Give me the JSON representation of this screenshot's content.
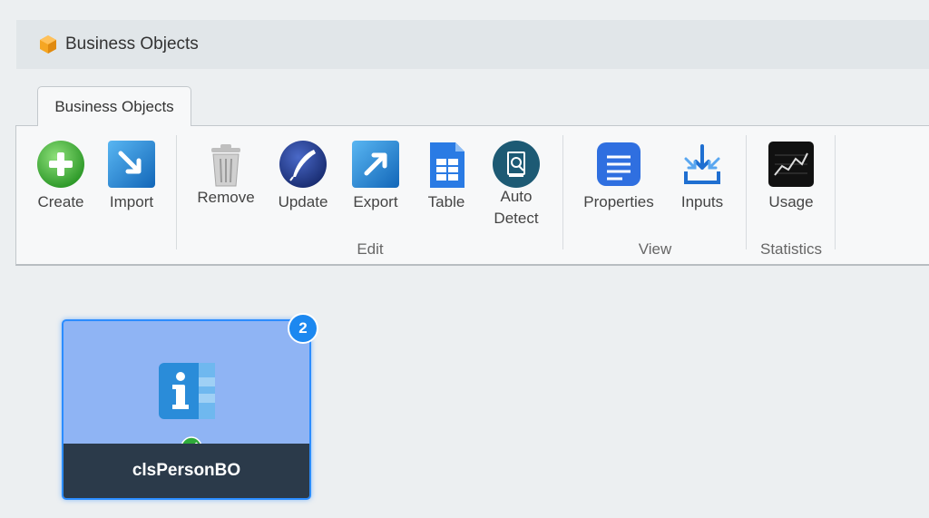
{
  "header": {
    "title": "Business Objects",
    "icon": "cube-icon"
  },
  "tab": {
    "label": "Business Objects"
  },
  "ribbon": {
    "create": "Create",
    "import": "Import",
    "remove": "Remove",
    "update": "Update",
    "export": "Export",
    "table": "Table",
    "auto_detect": "Auto\nDetect",
    "properties": "Properties",
    "inputs": "Inputs",
    "usage": "Usage",
    "groups": {
      "edit": "Edit",
      "view": "View",
      "statistics": "Statistics"
    }
  },
  "card": {
    "name": "clsPersonBO",
    "badge": "2",
    "status": "valid-check-icon"
  },
  "colors": {
    "accent": "#1c88f0",
    "card_bg": "#8fb4f4",
    "card_footer": "#2b3a4a"
  }
}
